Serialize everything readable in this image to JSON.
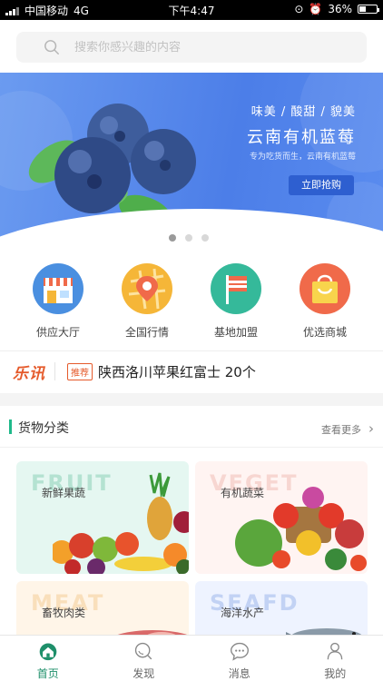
{
  "status_bar": {
    "carrier": "中国移动",
    "network": "4G",
    "time": "下午4:47",
    "battery": "36%"
  },
  "search": {
    "placeholder": "搜索你感兴趣的内容"
  },
  "banner": {
    "tagline": "味美 / 酸甜 / 貌美",
    "title": "云南有机蓝莓",
    "subtitle": "专为吃货而生，云南有机蓝莓",
    "button": "立即抢购",
    "dots_count": 3,
    "active_dot": 0
  },
  "quick_nav": [
    {
      "label": "供应大厅",
      "icon": "storefront-icon",
      "color": "#4a8fe0"
    },
    {
      "label": "全国行情",
      "icon": "map-pin-icon",
      "color": "#f5b638"
    },
    {
      "label": "基地加盟",
      "icon": "flag-icon",
      "color": "#35b99a"
    },
    {
      "label": "优选商城",
      "icon": "shopping-bag-icon",
      "color": "#f06a4a"
    }
  ],
  "news": {
    "brand": "乐讯",
    "tag": "推荐",
    "text": "陕西洛川苹果红富士 20个"
  },
  "section": {
    "title": "货物分类",
    "more": "查看更多"
  },
  "categories": [
    {
      "label": "新鲜果蔬",
      "ghost": "FRUIT"
    },
    {
      "label": "有机蔬菜",
      "ghost": "VEGET"
    },
    {
      "label": "畜牧肉类",
      "ghost": "MEAT"
    },
    {
      "label": "海洋水产",
      "ghost": "SEAFD"
    }
  ],
  "tabs": [
    {
      "label": "首页",
      "icon": "home-icon",
      "active": true
    },
    {
      "label": "发现",
      "icon": "discover-icon",
      "active": false
    },
    {
      "label": "消息",
      "icon": "message-icon",
      "active": false
    },
    {
      "label": "我的",
      "icon": "profile-icon",
      "active": false
    }
  ],
  "colors": {
    "accent_green": "#1fb98a",
    "banner_blue": "#4c7ee8",
    "brand_orange": "#e55a2b"
  }
}
